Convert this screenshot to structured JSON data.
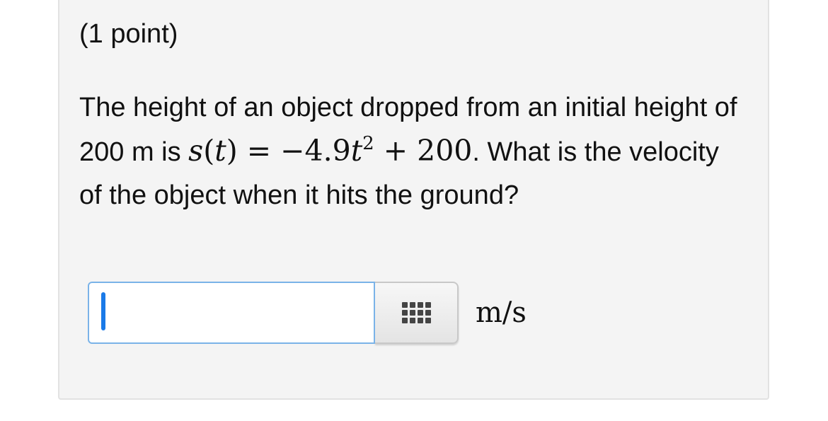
{
  "problem": {
    "points": "(1 point)",
    "question_before": "The height of an object dropped from an initial height of 200 m is ",
    "math": {
      "lhs_func": "s",
      "lhs_paren_open": "(",
      "lhs_var": "t",
      "lhs_paren_close": ")",
      "equals": " = ",
      "coef": "−4.9",
      "var": "t",
      "exponent": "2",
      "rest": " + 200"
    },
    "question_after": ". What is the velocity of the object when it hits the ground?"
  },
  "answer": {
    "value": "",
    "placeholder": "",
    "unit": "m/s"
  },
  "icons": {
    "palette": "grid-keypad-icon"
  }
}
